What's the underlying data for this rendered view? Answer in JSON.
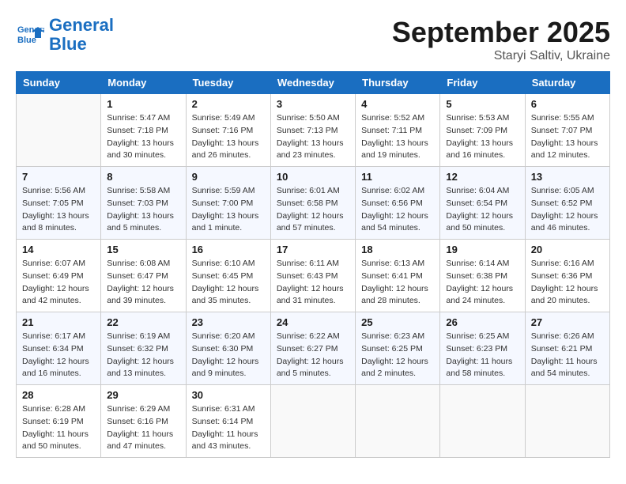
{
  "header": {
    "logo_line1": "General",
    "logo_line2": "Blue",
    "month": "September 2025",
    "location": "Staryi Saltiv, Ukraine"
  },
  "weekdays": [
    "Sunday",
    "Monday",
    "Tuesday",
    "Wednesday",
    "Thursday",
    "Friday",
    "Saturday"
  ],
  "weeks": [
    [
      {
        "day": "",
        "info": ""
      },
      {
        "day": "1",
        "info": "Sunrise: 5:47 AM\nSunset: 7:18 PM\nDaylight: 13 hours\nand 30 minutes."
      },
      {
        "day": "2",
        "info": "Sunrise: 5:49 AM\nSunset: 7:16 PM\nDaylight: 13 hours\nand 26 minutes."
      },
      {
        "day": "3",
        "info": "Sunrise: 5:50 AM\nSunset: 7:13 PM\nDaylight: 13 hours\nand 23 minutes."
      },
      {
        "day": "4",
        "info": "Sunrise: 5:52 AM\nSunset: 7:11 PM\nDaylight: 13 hours\nand 19 minutes."
      },
      {
        "day": "5",
        "info": "Sunrise: 5:53 AM\nSunset: 7:09 PM\nDaylight: 13 hours\nand 16 minutes."
      },
      {
        "day": "6",
        "info": "Sunrise: 5:55 AM\nSunset: 7:07 PM\nDaylight: 13 hours\nand 12 minutes."
      }
    ],
    [
      {
        "day": "7",
        "info": "Sunrise: 5:56 AM\nSunset: 7:05 PM\nDaylight: 13 hours\nand 8 minutes."
      },
      {
        "day": "8",
        "info": "Sunrise: 5:58 AM\nSunset: 7:03 PM\nDaylight: 13 hours\nand 5 minutes."
      },
      {
        "day": "9",
        "info": "Sunrise: 5:59 AM\nSunset: 7:00 PM\nDaylight: 13 hours\nand 1 minute."
      },
      {
        "day": "10",
        "info": "Sunrise: 6:01 AM\nSunset: 6:58 PM\nDaylight: 12 hours\nand 57 minutes."
      },
      {
        "day": "11",
        "info": "Sunrise: 6:02 AM\nSunset: 6:56 PM\nDaylight: 12 hours\nand 54 minutes."
      },
      {
        "day": "12",
        "info": "Sunrise: 6:04 AM\nSunset: 6:54 PM\nDaylight: 12 hours\nand 50 minutes."
      },
      {
        "day": "13",
        "info": "Sunrise: 6:05 AM\nSunset: 6:52 PM\nDaylight: 12 hours\nand 46 minutes."
      }
    ],
    [
      {
        "day": "14",
        "info": "Sunrise: 6:07 AM\nSunset: 6:49 PM\nDaylight: 12 hours\nand 42 minutes."
      },
      {
        "day": "15",
        "info": "Sunrise: 6:08 AM\nSunset: 6:47 PM\nDaylight: 12 hours\nand 39 minutes."
      },
      {
        "day": "16",
        "info": "Sunrise: 6:10 AM\nSunset: 6:45 PM\nDaylight: 12 hours\nand 35 minutes."
      },
      {
        "day": "17",
        "info": "Sunrise: 6:11 AM\nSunset: 6:43 PM\nDaylight: 12 hours\nand 31 minutes."
      },
      {
        "day": "18",
        "info": "Sunrise: 6:13 AM\nSunset: 6:41 PM\nDaylight: 12 hours\nand 28 minutes."
      },
      {
        "day": "19",
        "info": "Sunrise: 6:14 AM\nSunset: 6:38 PM\nDaylight: 12 hours\nand 24 minutes."
      },
      {
        "day": "20",
        "info": "Sunrise: 6:16 AM\nSunset: 6:36 PM\nDaylight: 12 hours\nand 20 minutes."
      }
    ],
    [
      {
        "day": "21",
        "info": "Sunrise: 6:17 AM\nSunset: 6:34 PM\nDaylight: 12 hours\nand 16 minutes."
      },
      {
        "day": "22",
        "info": "Sunrise: 6:19 AM\nSunset: 6:32 PM\nDaylight: 12 hours\nand 13 minutes."
      },
      {
        "day": "23",
        "info": "Sunrise: 6:20 AM\nSunset: 6:30 PM\nDaylight: 12 hours\nand 9 minutes."
      },
      {
        "day": "24",
        "info": "Sunrise: 6:22 AM\nSunset: 6:27 PM\nDaylight: 12 hours\nand 5 minutes."
      },
      {
        "day": "25",
        "info": "Sunrise: 6:23 AM\nSunset: 6:25 PM\nDaylight: 12 hours\nand 2 minutes."
      },
      {
        "day": "26",
        "info": "Sunrise: 6:25 AM\nSunset: 6:23 PM\nDaylight: 11 hours\nand 58 minutes."
      },
      {
        "day": "27",
        "info": "Sunrise: 6:26 AM\nSunset: 6:21 PM\nDaylight: 11 hours\nand 54 minutes."
      }
    ],
    [
      {
        "day": "28",
        "info": "Sunrise: 6:28 AM\nSunset: 6:19 PM\nDaylight: 11 hours\nand 50 minutes."
      },
      {
        "day": "29",
        "info": "Sunrise: 6:29 AM\nSunset: 6:16 PM\nDaylight: 11 hours\nand 47 minutes."
      },
      {
        "day": "30",
        "info": "Sunrise: 6:31 AM\nSunset: 6:14 PM\nDaylight: 11 hours\nand 43 minutes."
      },
      {
        "day": "",
        "info": ""
      },
      {
        "day": "",
        "info": ""
      },
      {
        "day": "",
        "info": ""
      },
      {
        "day": "",
        "info": ""
      }
    ]
  ]
}
